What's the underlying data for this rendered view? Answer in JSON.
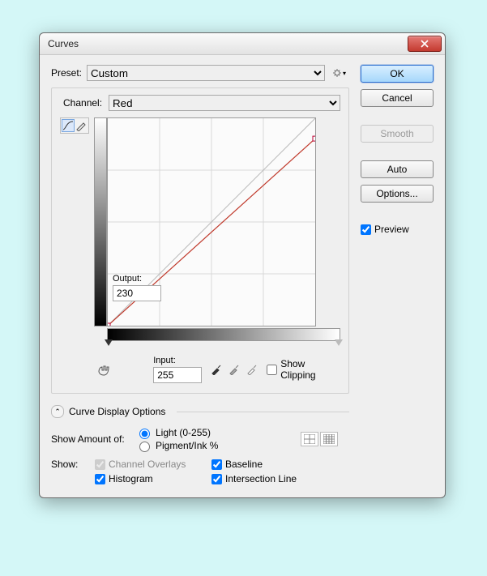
{
  "window": {
    "title": "Curves"
  },
  "preset": {
    "label": "Preset:",
    "value": "Custom",
    "gear_icon": "gear"
  },
  "channel": {
    "label": "Channel:",
    "value": "Red"
  },
  "axes": {
    "output_label": "Output:",
    "output_value": "230",
    "input_label": "Input:",
    "input_value": "255"
  },
  "show_clipping": {
    "label": "Show Clipping",
    "checked": false
  },
  "curve_display": {
    "toggle_label": "Curve Display Options",
    "amount_label": "Show Amount of:",
    "light_label": "Light  (0-255)",
    "pigment_label": "Pigment/Ink %",
    "show_label": "Show:",
    "channel_overlays": "Channel Overlays",
    "histogram": "Histogram",
    "baseline": "Baseline",
    "intersection": "Intersection Line"
  },
  "buttons": {
    "ok": "OK",
    "cancel": "Cancel",
    "smooth": "Smooth",
    "auto": "Auto",
    "options": "Options..."
  },
  "preview": {
    "label": "Preview",
    "checked": true
  },
  "chart_data": {
    "type": "line",
    "title": "Red channel curve",
    "xlabel": "Input",
    "ylabel": "Output",
    "xlim": [
      0,
      255
    ],
    "ylim": [
      0,
      255
    ],
    "grid": true,
    "points": [
      {
        "x": 0,
        "y": 0
      },
      {
        "x": 255,
        "y": 230
      }
    ],
    "baseline": [
      {
        "x": 0,
        "y": 0
      },
      {
        "x": 255,
        "y": 255
      }
    ],
    "selected_point_index": 1
  }
}
